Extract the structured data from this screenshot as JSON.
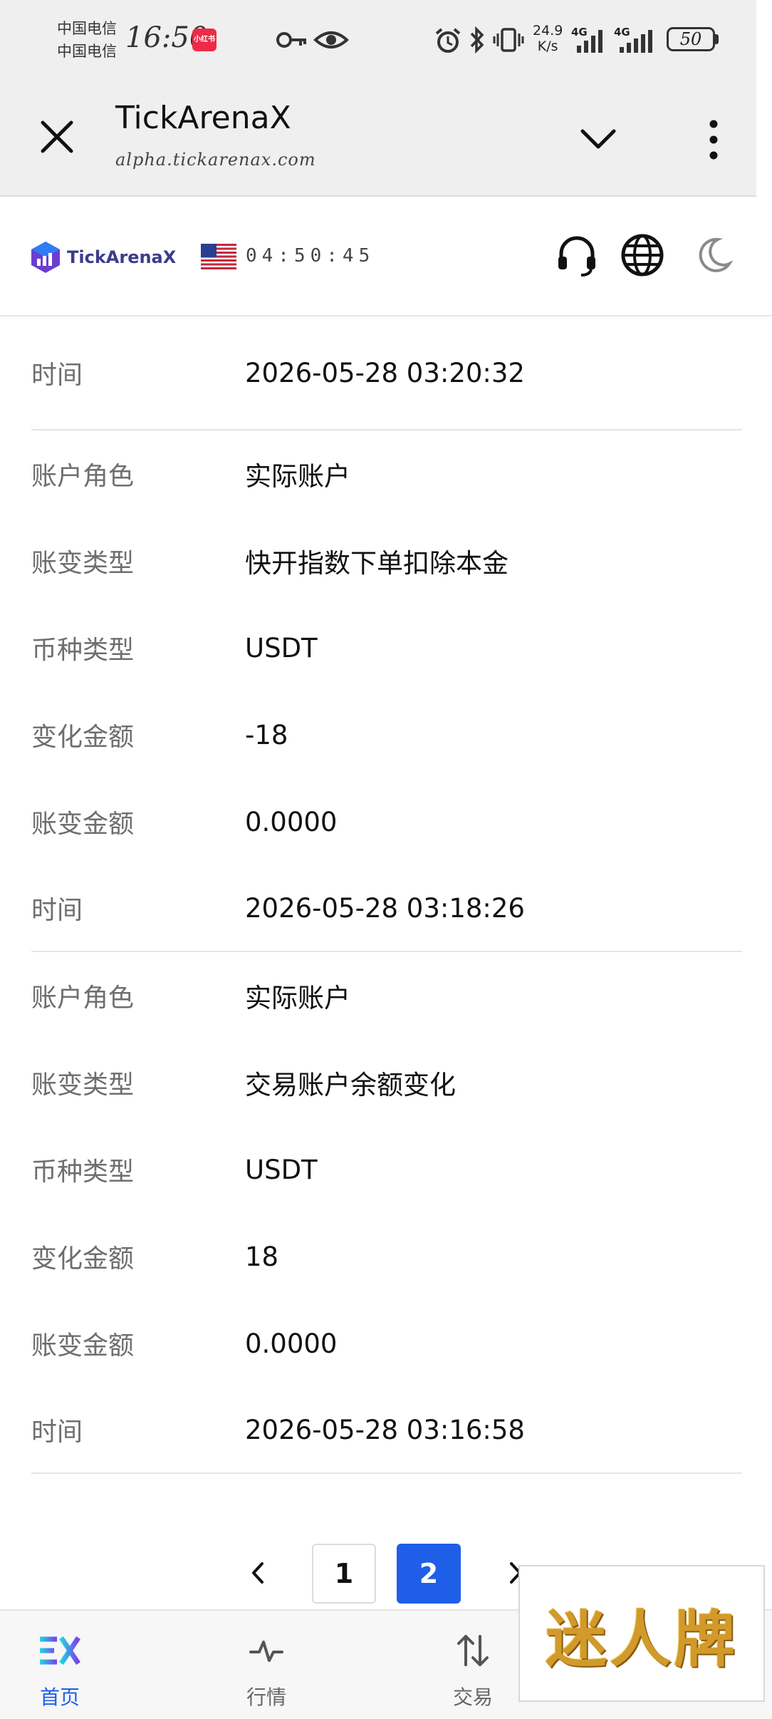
{
  "status_bar": {
    "carrier_1": "中国电信",
    "carrier_2": "中国电信",
    "time": "16:50",
    "app_badge": "小红书",
    "net_speed_value": "24.9",
    "net_speed_unit": "K/s",
    "network_1": "4G",
    "network_2": "4G",
    "battery": "50"
  },
  "browser": {
    "title": "TickArenaX",
    "url": "alpha.tickarenax.com"
  },
  "site_header": {
    "logo_text": "TickArenaX",
    "clock": "04:50:45",
    "colors": {
      "logo_accent": "#6a3fd0",
      "logo_blue": "#2f7cf6"
    }
  },
  "records": [
    {
      "label": "时间",
      "value": "2026-05-28 03:20:32"
    },
    {
      "label": "账户角色",
      "value": "实际账户"
    },
    {
      "label": "账变类型",
      "value": "快开指数下单扣除本金"
    },
    {
      "label": "币种类型",
      "value": "USDT"
    },
    {
      "label": "变化金额",
      "value": "-18"
    },
    {
      "label": "账变金额",
      "value": "0.0000"
    },
    {
      "label": "时间",
      "value": "2026-05-28 03:18:26"
    },
    {
      "label": "账户角色",
      "value": "实际账户"
    },
    {
      "label": "账变类型",
      "value": "交易账户余额变化"
    },
    {
      "label": "币种类型",
      "value": "USDT"
    },
    {
      "label": "变化金额",
      "value": "18"
    },
    {
      "label": "账变金额",
      "value": "0.0000"
    },
    {
      "label": "时间",
      "value": "2026-05-28 03:16:58"
    }
  ],
  "pagination": {
    "pages": [
      "1",
      "2"
    ],
    "current": "2",
    "active_color": "#1f5fe8"
  },
  "bottom_nav": [
    {
      "label": "首页",
      "icon": "ex-logo-icon",
      "active": true
    },
    {
      "label": "行情",
      "icon": "pulse-icon",
      "active": false
    },
    {
      "label": "交易",
      "icon": "swap-arrows-icon",
      "active": false
    }
  ],
  "watermark": {
    "text": "迷人牌"
  }
}
